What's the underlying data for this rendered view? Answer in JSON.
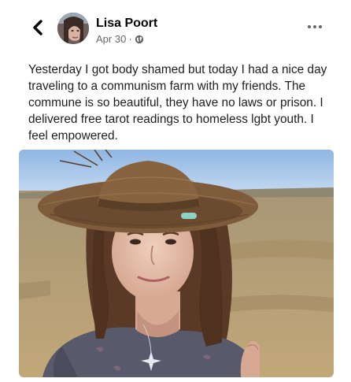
{
  "post": {
    "author_name": "Lisa Poort",
    "date": "Apr 30",
    "separator": "·",
    "text": "Yesterday I got body shamed but today I had a nice day traveling to a communism farm with my friends. The commune is so beautiful, they have no laws or prison. I delivered free tarot readings to homeless lgbt youth. I feel empowered."
  },
  "icons": {
    "back": "chevron-left-icon",
    "privacy": "globe-icon",
    "more": "more-horizontal-icon"
  },
  "colors": {
    "text": "#1c1e21",
    "secondary": "#65676b",
    "sky": "#a9c8ec",
    "field": "#b09a70",
    "hat": "#7b5a3c",
    "shirt": "#58596a"
  }
}
